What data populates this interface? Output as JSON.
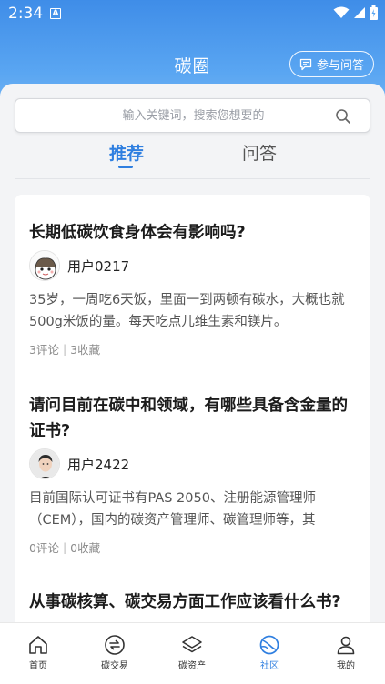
{
  "status_bar": {
    "time": "2:34",
    "notification_letter": "A"
  },
  "header": {
    "title": "碳圈",
    "ask_button_label": "参与问答"
  },
  "search": {
    "placeholder": "输入关键词，搜索您想要的"
  },
  "tabs": [
    {
      "label": "推荐",
      "active": true
    },
    {
      "label": "问答",
      "active": false
    }
  ],
  "posts": [
    {
      "title": "长期低碳饮食身体会有影响吗?",
      "author": "用户0217",
      "body": "35岁，一周吃6天饭，里面一到两顿有碳水，大概也就500g米饭的量。每天吃点儿维生素和镁片。",
      "comments": "3评论",
      "favorites": "3收藏"
    },
    {
      "title": "请问目前在碳中和领域，有哪些具备含金量的证书?",
      "author": "用户2422",
      "body": "目前国际认可证书有PAS 2050、注册能源管理师（CEM），国内的碳资产管理师、碳管理师等，其",
      "comments": "0评论",
      "favorites": "0收藏"
    },
    {
      "title": "从事碳核算、碳交易方面工作应该看什么书?"
    }
  ],
  "bottom_nav": [
    {
      "label": "首页",
      "icon": "home-icon",
      "active": false
    },
    {
      "label": "碳交易",
      "icon": "exchange-icon",
      "active": false
    },
    {
      "label": "碳资产",
      "icon": "layers-icon",
      "active": false
    },
    {
      "label": "社区",
      "icon": "planet-icon",
      "active": true
    },
    {
      "label": "我的",
      "icon": "user-icon",
      "active": false
    }
  ],
  "colors": {
    "accent": "#2f7fe0",
    "header_gradient_top": "#3f8de8",
    "header_gradient_bottom": "#7cbaf5"
  }
}
